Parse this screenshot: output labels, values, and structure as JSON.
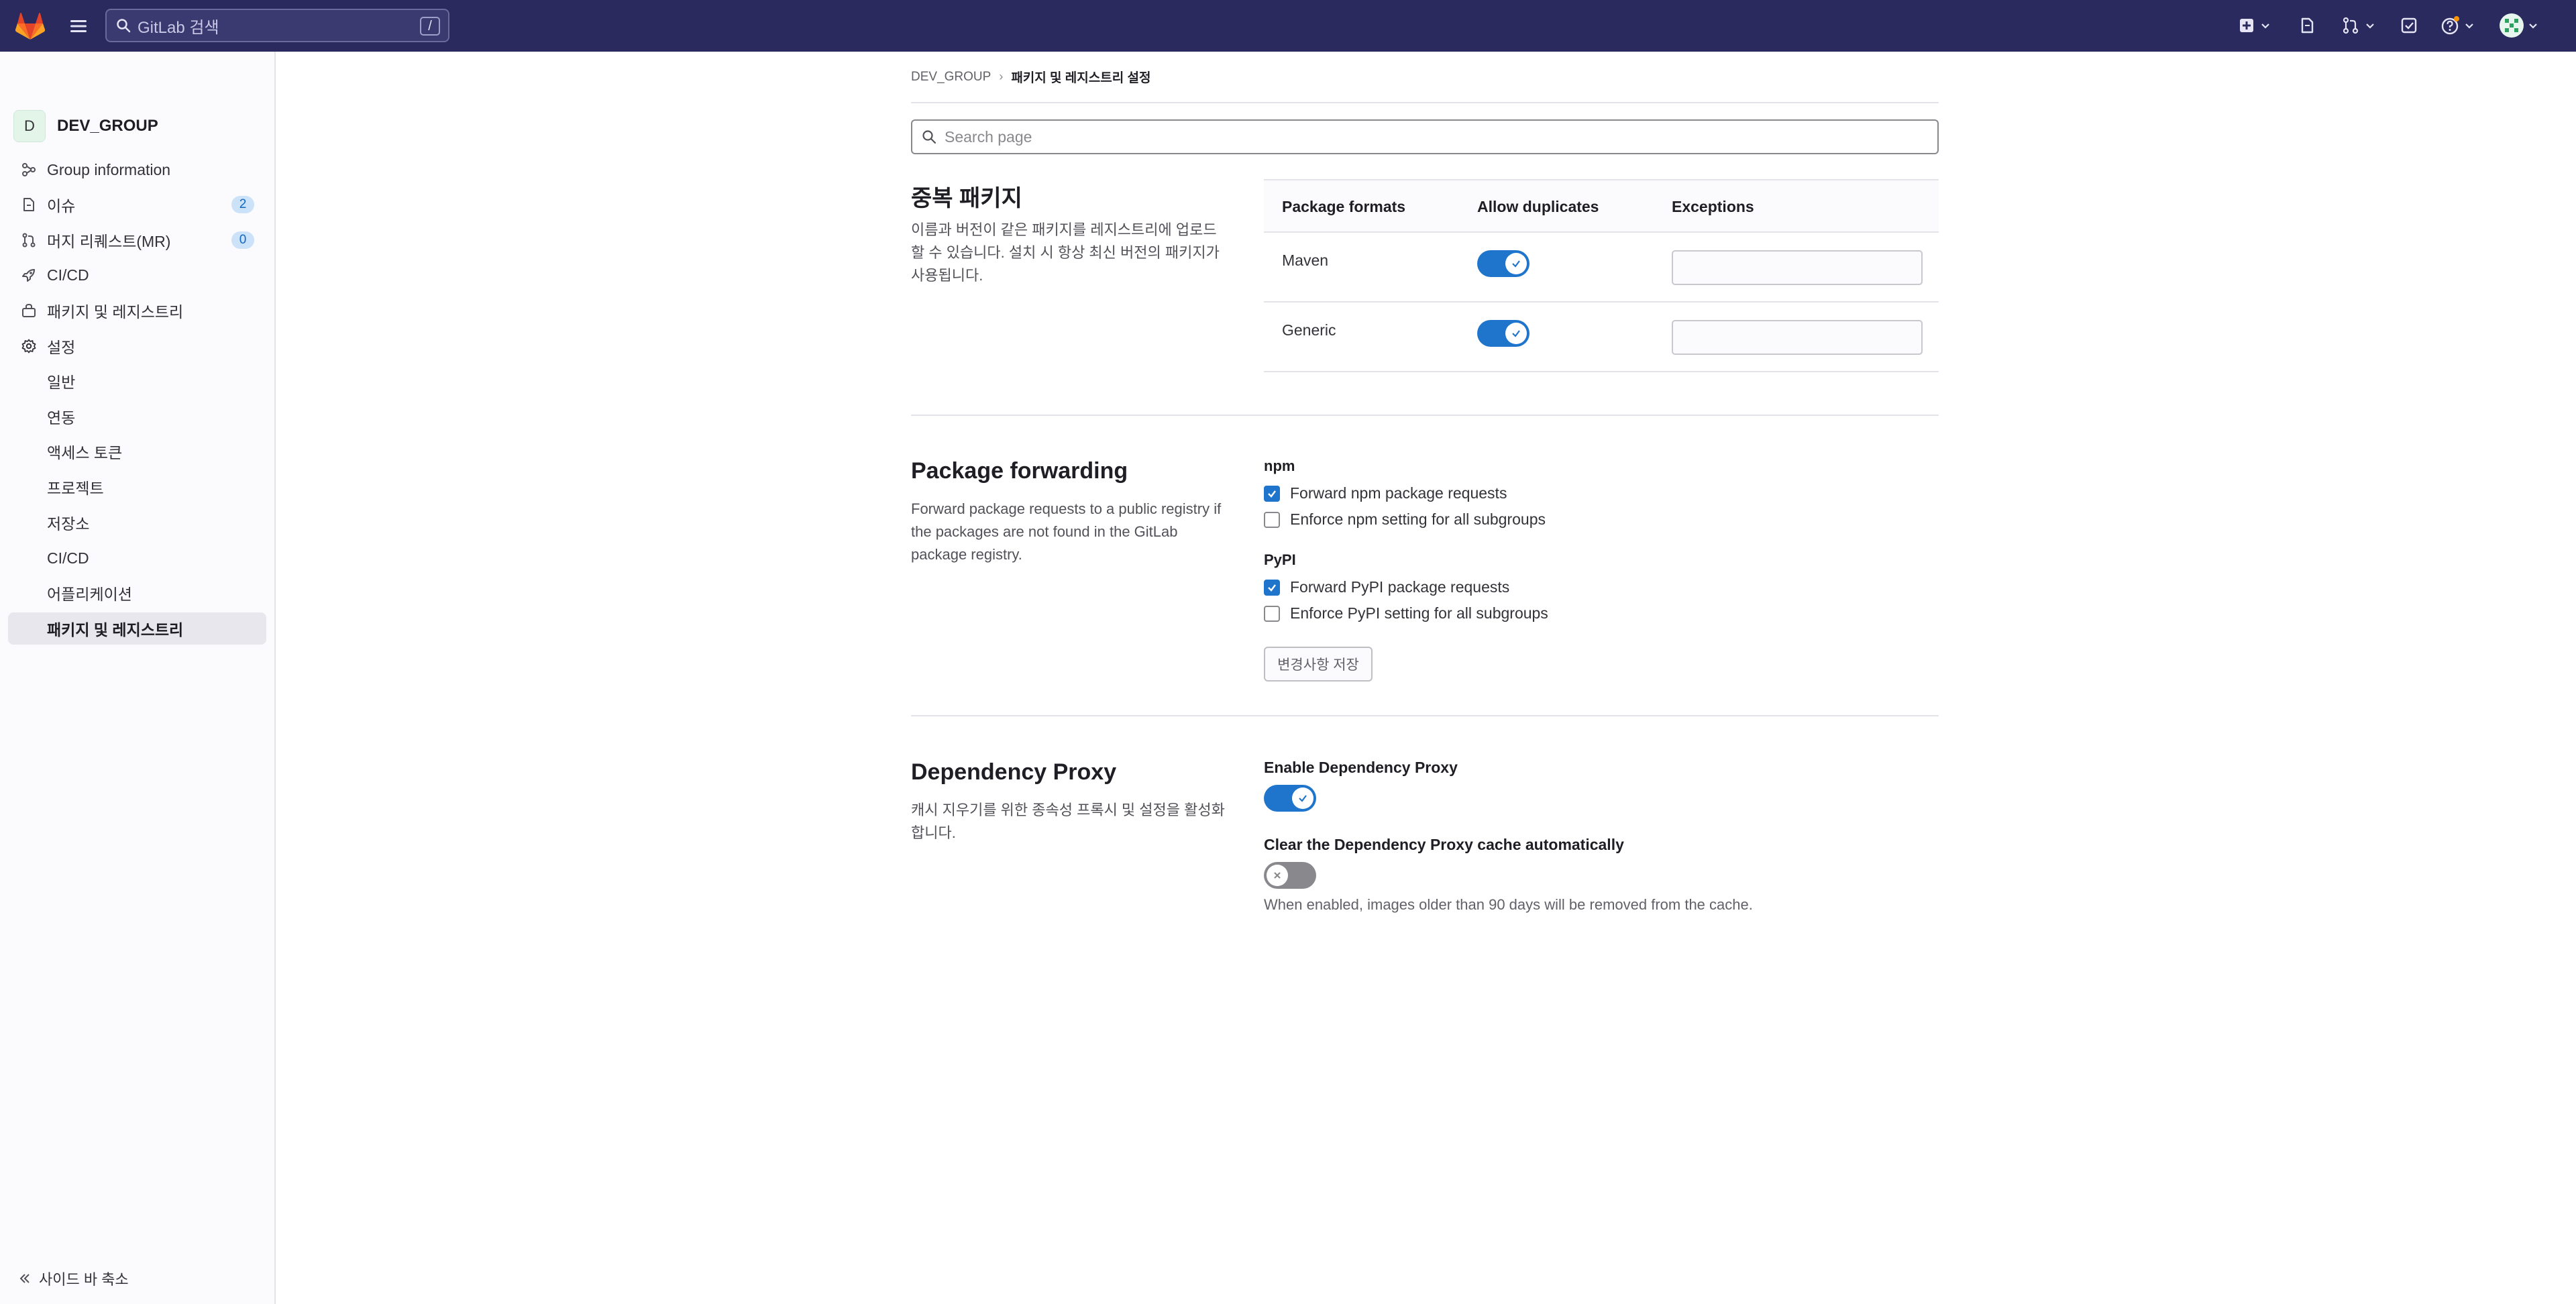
{
  "topbar": {
    "search_placeholder": "GitLab 검색",
    "search_shortcut": "/"
  },
  "sidebar": {
    "group_avatar_letter": "D",
    "group_name": "DEV_GROUP",
    "items": [
      {
        "label": "Group information",
        "icon": "group-info-icon"
      },
      {
        "label": "이슈",
        "icon": "issues-icon",
        "badge": "2"
      },
      {
        "label": "머지 리퀘스트(MR)",
        "icon": "merge-request-icon",
        "badge": "0"
      },
      {
        "label": "CI/CD",
        "icon": "rocket-icon"
      },
      {
        "label": "패키지 및 레지스트리",
        "icon": "package-icon"
      },
      {
        "label": "설정",
        "icon": "gear-icon"
      }
    ],
    "settings_items": [
      {
        "label": "일반"
      },
      {
        "label": "연동"
      },
      {
        "label": "액세스 토큰"
      },
      {
        "label": "프로젝트"
      },
      {
        "label": "저장소"
      },
      {
        "label": "CI/CD"
      },
      {
        "label": "어플리케이션"
      },
      {
        "label": "패키지 및 레지스트리",
        "active": true
      }
    ],
    "collapse_label": "사이드 바 축소"
  },
  "breadcrumb": {
    "group": "DEV_GROUP",
    "current": "패키지 및 레지스트리 설정"
  },
  "page_search": {
    "placeholder": "Search page"
  },
  "duplicates": {
    "title": "중복 패키지",
    "description": "이름과 버전이 같은 패키지를 레지스트리에 업로드할 수 있습니다. 설치 시 항상 최신 버전의 패키지가 사용됩니다.",
    "columns": [
      "Package formats",
      "Allow duplicates",
      "Exceptions"
    ],
    "rows": [
      {
        "format": "Maven",
        "allow_duplicates": true,
        "exceptions": ""
      },
      {
        "format": "Generic",
        "allow_duplicates": true,
        "exceptions": ""
      }
    ]
  },
  "forwarding": {
    "title": "Package forwarding",
    "description": "Forward package requests to a public registry if the packages are not found in the GitLab package registry.",
    "npm": {
      "label": "npm",
      "forward_label": "Forward npm package requests",
      "forward_checked": true,
      "enforce_label": "Enforce npm setting for all subgroups",
      "enforce_checked": false
    },
    "pypi": {
      "label": "PyPI",
      "forward_label": "Forward PyPI package requests",
      "forward_checked": true,
      "enforce_label": "Enforce PyPI setting for all subgroups",
      "enforce_checked": false
    },
    "save_label": "변경사항 저장"
  },
  "dependency_proxy": {
    "title": "Dependency Proxy",
    "description": "캐시 지우기를 위한 종속성 프록시 및 설정을 활성화합니다.",
    "enable_label": "Enable Dependency Proxy",
    "enable_on": true,
    "clear_label": "Clear the Dependency Proxy cache automatically",
    "clear_on": false,
    "clear_help": "When enabled, images older than 90 days will be removed from the cache."
  },
  "colors": {
    "topbar": "#2b2a5e",
    "accent": "#1f75cb",
    "badge_bg": "#cbe2f9"
  }
}
